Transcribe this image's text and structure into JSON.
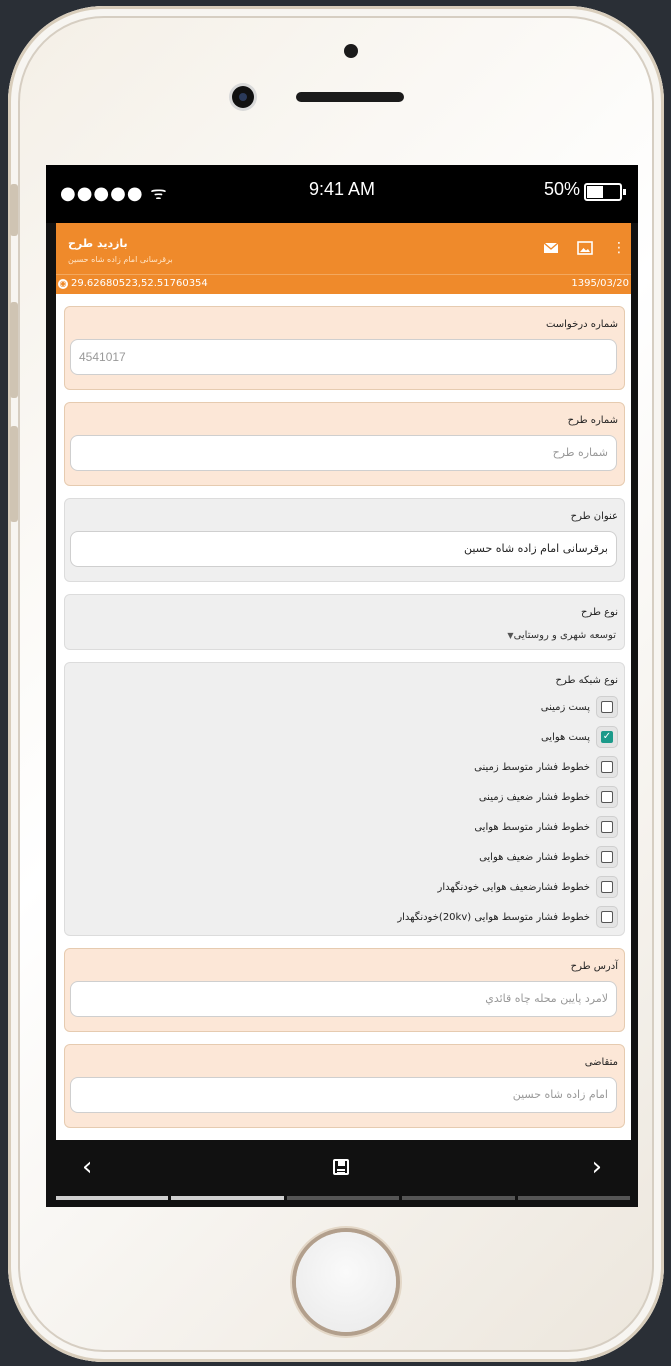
{
  "status_bar": {
    "signal": "●●●●● ᯤ",
    "time": "9:41 AM",
    "battery": "50%"
  },
  "appbar": {
    "title": "بازدید طرح",
    "subtitle": "برقرسانی امام زاده شاه حسین",
    "icons": [
      "mail-icon",
      "image-icon",
      "more-vertical-icon"
    ]
  },
  "coords": {
    "location": "29.62680523,52.51760354",
    "date": "1395/03/20"
  },
  "form": {
    "request_number": {
      "label": "شماره درخواست",
      "value": "4541017"
    },
    "plan_number": {
      "label": "شماره طرح",
      "placeholder": "شماره طرح"
    },
    "plan_title": {
      "label": "عنوان طرح",
      "value": "برقرسانی امام زاده شاه حسین"
    },
    "plan_type": {
      "label": "نوع طرح",
      "selected": "توسعه شهری و روستایی"
    },
    "network_type": {
      "label": "نوع شبکه طرح",
      "options": [
        {
          "label": "پست زمینی",
          "checked": false
        },
        {
          "label": "پست هوایی",
          "checked": true
        },
        {
          "label": "خطوط فشار متوسط زمینی",
          "checked": false
        },
        {
          "label": "خطوط فشار ضعیف زمینی",
          "checked": false
        },
        {
          "label": "خطوط فشار متوسط هوایی",
          "checked": false
        },
        {
          "label": "خطوط فشار ضعیف هوایی",
          "checked": false
        },
        {
          "label": "خطوط فشارضعیف هوایی خودنگهدار",
          "checked": false
        },
        {
          "label": "خطوط فشار متوسط هوایی (20kv)خودنگهدار",
          "checked": false
        }
      ]
    },
    "plan_address": {
      "label": "آدرس طرح",
      "placeholder": "لامرد پایین محله چاه قائدي"
    },
    "applicant": {
      "label": "متقاضی",
      "placeholder": "امام زاده شاه حسین"
    }
  },
  "bottom_nav": {
    "prev": "‹",
    "next": "›",
    "steps_total": 5,
    "steps_done": 2
  },
  "colors": {
    "accent": "#ef8a2b",
    "card_bg": "#fce7d7",
    "check": "#1c9a8a"
  }
}
